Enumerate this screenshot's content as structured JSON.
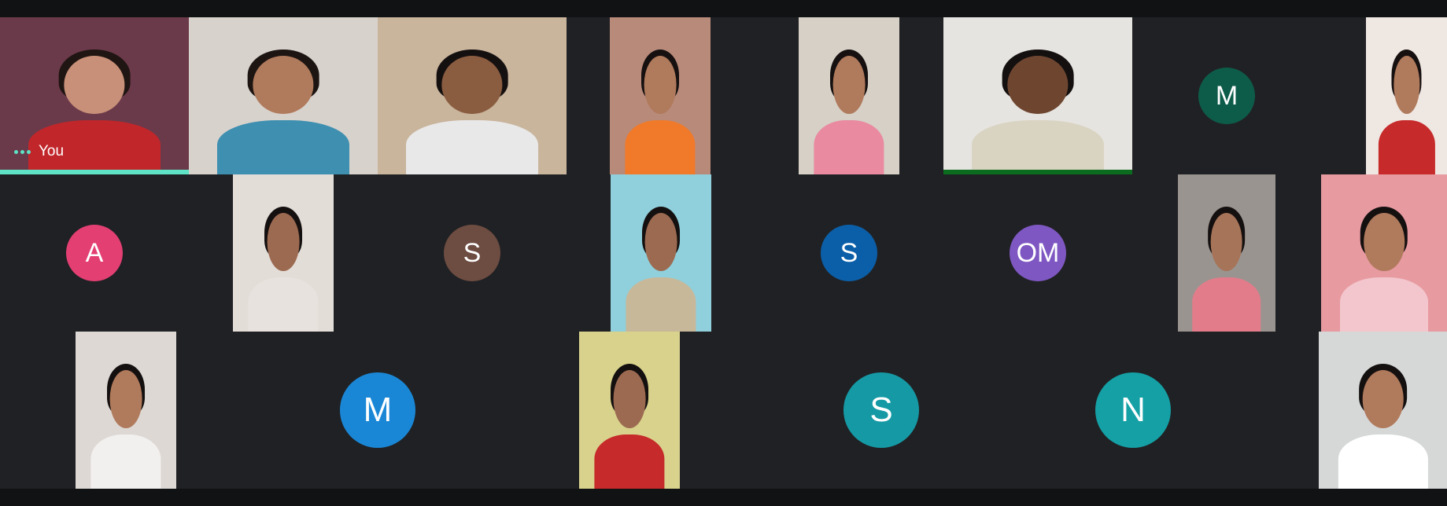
{
  "meeting": {
    "self_label": "You",
    "tiles": [
      {
        "id": "self",
        "type": "video",
        "label": "You",
        "speaking": true,
        "bg": "#6b3a4a",
        "skin": "#c89078",
        "hair": "#1f1512",
        "shirt": "#c1262a"
      },
      {
        "id": "p2",
        "type": "video",
        "bg": "#d8d2cc",
        "skin": "#b07a5c",
        "hair": "#1c1512",
        "shirt": "#3e8fb0"
      },
      {
        "id": "p3",
        "type": "video",
        "bg": "#c9b49c",
        "skin": "#8a5c40",
        "hair": "#151010",
        "shirt": "#e8e8e8"
      },
      {
        "id": "p4",
        "type": "video",
        "bg": "#b88a7a",
        "skin": "#b07a5c",
        "hair": "#161010",
        "shirt": "#f07a2a"
      },
      {
        "id": "p5",
        "type": "video",
        "bg": "#d6d0c6",
        "skin": "#b07a5c",
        "hair": "#161010",
        "shirt": "#e98aa0"
      },
      {
        "id": "p6",
        "type": "video",
        "speaking_green": true,
        "bg": "#e6e4e0",
        "skin": "#6e4630",
        "hair": "#141010",
        "shirt": "#d9d4c2"
      },
      {
        "id": "m1",
        "type": "avatar",
        "initial": "M",
        "color": "#0d5c4a"
      },
      {
        "id": "p7",
        "type": "video",
        "bg": "#efe7e2",
        "skin": "#b07a5c",
        "hair": "#161010",
        "shirt": "#c62a2a"
      },
      {
        "id": "a1",
        "type": "avatar",
        "initial": "A",
        "color": "#e33f73"
      },
      {
        "id": "p8",
        "type": "video",
        "bg": "#e3ddd8",
        "skin": "#9c6a50",
        "hair": "#151010",
        "shirt": "#e8e2de"
      },
      {
        "id": "s1",
        "type": "avatar",
        "initial": "S",
        "color": "#6d4c41"
      },
      {
        "id": "p9",
        "type": "video",
        "bg": "#8fd0dc",
        "skin": "#9c6a50",
        "hair": "#151010",
        "shirt": "#c8b89a"
      },
      {
        "id": "s2",
        "type": "avatar",
        "initial": "S",
        "color": "#0b5fa8"
      },
      {
        "id": "om",
        "type": "avatar",
        "initial": "OM",
        "color": "#7e57c2"
      },
      {
        "id": "p10",
        "type": "video",
        "bg": "#9a9490",
        "skin": "#a67458",
        "hair": "#151010",
        "shirt": "#e37c8a"
      },
      {
        "id": "p11",
        "type": "video",
        "bg": "#e79aa0",
        "skin": "#b07a5c",
        "hair": "#151010",
        "shirt": "#f2c6cc"
      },
      {
        "id": "p12",
        "type": "video",
        "bg": "#ddd8d4",
        "skin": "#b07a5c",
        "hair": "#151010",
        "shirt": "#f2f0ee"
      },
      {
        "id": "m2",
        "type": "avatar",
        "initial": "M",
        "color": "#1a87d6"
      },
      {
        "id": "p13",
        "type": "video",
        "bg": "#d8d28c",
        "skin": "#9c6a50",
        "hair": "#151010",
        "shirt": "#c62a2a"
      },
      {
        "id": "s3",
        "type": "avatar",
        "initial": "S",
        "color": "#159aa5"
      },
      {
        "id": "n1",
        "type": "avatar",
        "initial": "N",
        "color": "#14a0a5"
      },
      {
        "id": "p14",
        "type": "video",
        "bg": "#d6d8d8",
        "skin": "#b07a5c",
        "hair": "#151010",
        "shirt": "#ffffff"
      }
    ]
  }
}
